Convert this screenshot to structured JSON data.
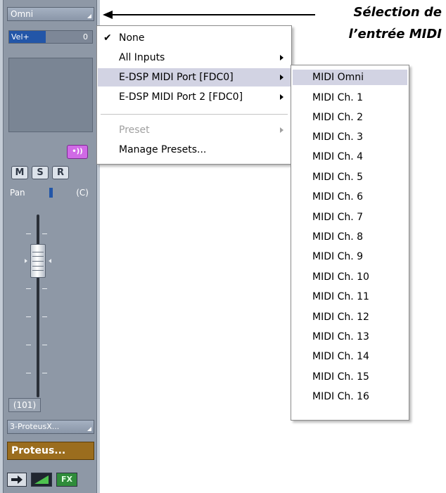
{
  "strip": {
    "input_select": "Omni",
    "velocity": {
      "label": "Vel+",
      "value": "0"
    },
    "mute_label": "M",
    "solo_label": "S",
    "record_label": "R",
    "fx_send_label": "•))",
    "pan": {
      "label": "Pan",
      "value": "(C)"
    },
    "fader_level": "(101)",
    "output_select": "3-ProteusX...",
    "track_name": "Proteus...",
    "fx_button_label": "FX"
  },
  "menu": {
    "items": [
      {
        "label": "None",
        "checked": true
      },
      {
        "label": "All Inputs",
        "submenu": true
      },
      {
        "label": "E-DSP MIDI Port [FDC0]",
        "submenu": true,
        "selected": true
      },
      {
        "label": "E-DSP MIDI Port 2 [FDC0]",
        "submenu": true
      },
      {
        "label": "Preset",
        "submenu": true,
        "disabled": true
      },
      {
        "label": "Manage Presets..."
      }
    ],
    "check_glyph": "✔"
  },
  "submenu": {
    "items": [
      "MIDI Omni",
      "MIDI Ch. 1",
      "MIDI Ch. 2",
      "MIDI Ch. 3",
      "MIDI Ch. 4",
      "MIDI Ch. 5",
      "MIDI Ch. 6",
      "MIDI Ch. 7",
      "MIDI Ch. 8",
      "MIDI Ch. 9",
      "MIDI Ch. 10",
      "MIDI Ch. 11",
      "MIDI Ch. 12",
      "MIDI Ch. 13",
      "MIDI Ch. 14",
      "MIDI Ch. 15",
      "MIDI Ch. 16"
    ],
    "selected_index": 0
  },
  "annotation": {
    "line1": "Sélection de",
    "line2": "l’entrée MIDI"
  },
  "colors": {
    "strip_bg": "#8e98a6",
    "menu_highlight": "#d2d3e3",
    "fx_send": "#d06ae6",
    "track_name_bg": "#9b6d1e"
  }
}
